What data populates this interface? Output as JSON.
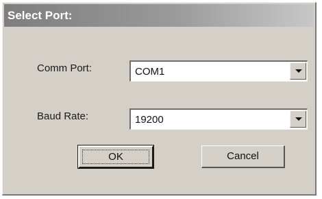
{
  "window": {
    "title": "Select Port:"
  },
  "form": {
    "comm_port": {
      "label": "Comm Port:",
      "value": "COM1"
    },
    "baud_rate": {
      "label": "Baud Rate:",
      "value": "19200"
    }
  },
  "buttons": {
    "ok_label": "OK",
    "cancel_label": "Cancel"
  },
  "icons": {
    "dropdown": "chevron-down-icon"
  },
  "colors": {
    "dialog_background": "#d4d0c8",
    "titlebar_start": "#7e7e7e",
    "titlebar_end": "#c8c8c8",
    "title_text": "#ffffff"
  }
}
